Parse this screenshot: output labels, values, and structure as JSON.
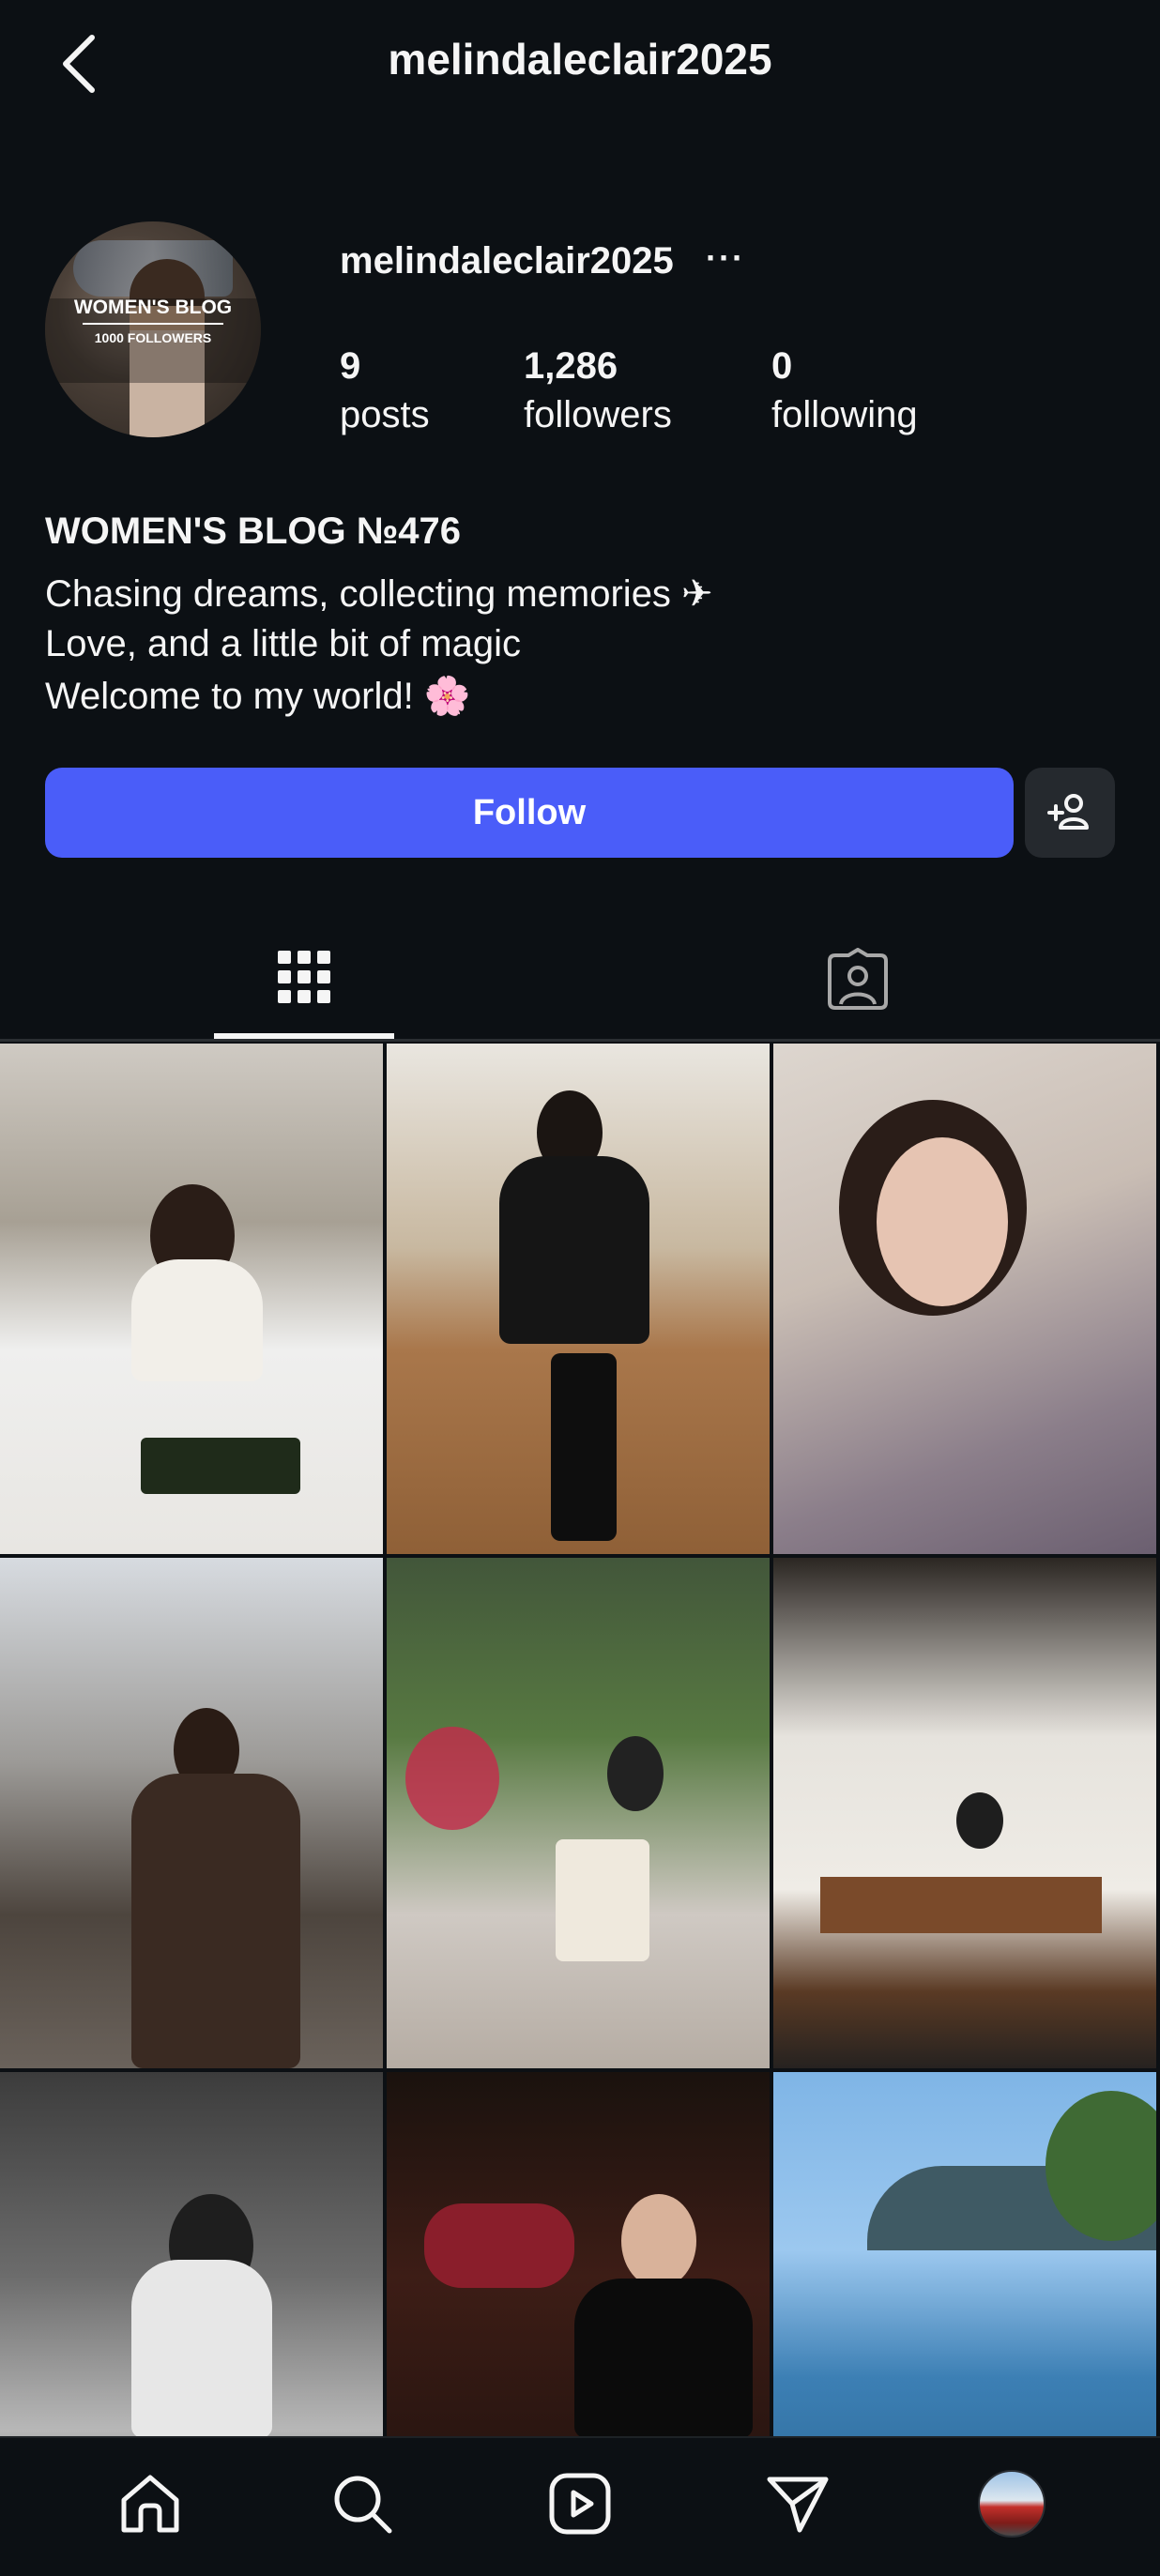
{
  "header": {
    "title": "melindaleclair2025"
  },
  "profile": {
    "username": "melindaleclair2025",
    "more": "···",
    "avatar_text_1": "WOMEN'S BLOG",
    "avatar_text_2": "1000 FOLLOWERS",
    "stats": [
      {
        "value": "9",
        "label": "posts"
      },
      {
        "value": "1,286",
        "label": "followers"
      },
      {
        "value": "0",
        "label": "following"
      }
    ],
    "bio_name": "WOMEN'S BLOG №476",
    "bio_lines": [
      "Chasing dreams, collecting memories ✈",
      "Love, and a little bit of magic",
      "Welcome to my world! 🌸"
    ]
  },
  "actions": {
    "follow_label": "Follow"
  },
  "tabs": [
    {
      "icon": "grid-icon",
      "active": true
    },
    {
      "icon": "tagged-icon",
      "active": false
    }
  ],
  "posts_count": 9,
  "colors": {
    "background": "#0c1014",
    "follow_button": "#4a5df9",
    "secondary_button": "#25292e"
  },
  "bottom_nav": [
    "home-icon",
    "search-icon",
    "reels-icon",
    "direct-icon",
    "profile-avatar"
  ]
}
